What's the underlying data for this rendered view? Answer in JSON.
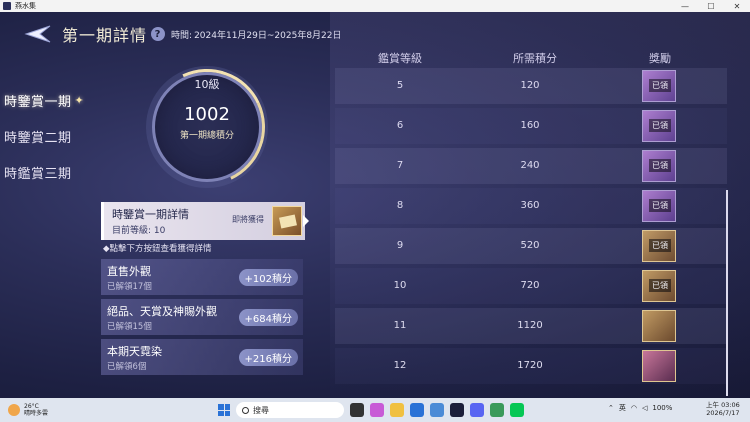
{
  "window": {
    "title": "燕水集",
    "minimize": "—",
    "maximize": "☐",
    "close": "✕"
  },
  "header": {
    "title": "第一期詳情",
    "help": "?",
    "period_label": "時間:",
    "period_value": "2024年11月29日~2025年8月22日"
  },
  "nav": {
    "items": [
      {
        "label": "時鑒賞一期",
        "active": true
      },
      {
        "label": "時鑒賞二期",
        "active": false
      },
      {
        "label": "時鑑賞三期",
        "active": false
      }
    ]
  },
  "ring": {
    "level": "10級",
    "points": "1002",
    "caption": "第一期總積分"
  },
  "detail_card": {
    "title": "時鑒賞一期詳情",
    "level_text": "目前等級: 10",
    "soon_text": "即將獲得"
  },
  "hint": "◆點擊下方按鈕查看獲得詳情",
  "categories": [
    {
      "name": "直售外觀",
      "sub": "已解領17個",
      "points": "+102積分"
    },
    {
      "name": "絕品、天賞及神賜外觀",
      "sub": "已解領15個",
      "points": "+684積分"
    },
    {
      "name": "本期天霓染",
      "sub": "已解領6個",
      "points": "+216積分"
    }
  ],
  "table": {
    "headers": {
      "level": "鑑賞等級",
      "points": "所需積分",
      "reward": "獎勵"
    },
    "rows": [
      {
        "level": "5",
        "points": "120",
        "reward_status": "已領",
        "reward_style": "purple"
      },
      {
        "level": "6",
        "points": "160",
        "reward_status": "已領",
        "reward_style": "purple"
      },
      {
        "level": "7",
        "points": "240",
        "reward_status": "已領",
        "reward_style": "purple"
      },
      {
        "level": "8",
        "points": "360",
        "reward_status": "已領",
        "reward_style": "purple"
      },
      {
        "level": "9",
        "points": "520",
        "reward_status": "已領",
        "reward_style": "gold"
      },
      {
        "level": "10",
        "points": "720",
        "reward_status": "已領",
        "reward_style": "gold"
      },
      {
        "level": "11",
        "points": "1120",
        "reward_status": "",
        "reward_style": "gold"
      },
      {
        "level": "12",
        "points": "1720",
        "reward_status": "",
        "reward_style": "pink"
      }
    ]
  },
  "taskbar": {
    "weather_temp": "26°C",
    "weather_desc": "晴時多雲",
    "search_text": "搜尋",
    "tray_lang": "英",
    "battery": "100%",
    "clock_time": "上午 03:06",
    "clock_date": "2026/7/17"
  }
}
